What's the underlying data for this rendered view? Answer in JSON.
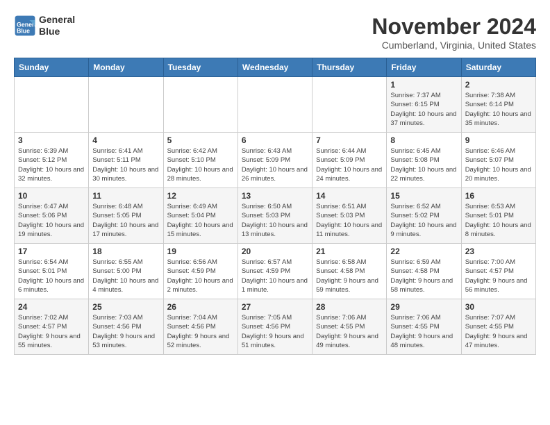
{
  "header": {
    "logo_line1": "General",
    "logo_line2": "Blue",
    "month_title": "November 2024",
    "location": "Cumberland, Virginia, United States"
  },
  "days_of_week": [
    "Sunday",
    "Monday",
    "Tuesday",
    "Wednesday",
    "Thursday",
    "Friday",
    "Saturday"
  ],
  "weeks": [
    [
      {
        "day": "",
        "info": ""
      },
      {
        "day": "",
        "info": ""
      },
      {
        "day": "",
        "info": ""
      },
      {
        "day": "",
        "info": ""
      },
      {
        "day": "",
        "info": ""
      },
      {
        "day": "1",
        "info": "Sunrise: 7:37 AM\nSunset: 6:15 PM\nDaylight: 10 hours and 37 minutes."
      },
      {
        "day": "2",
        "info": "Sunrise: 7:38 AM\nSunset: 6:14 PM\nDaylight: 10 hours and 35 minutes."
      }
    ],
    [
      {
        "day": "3",
        "info": "Sunrise: 6:39 AM\nSunset: 5:12 PM\nDaylight: 10 hours and 32 minutes."
      },
      {
        "day": "4",
        "info": "Sunrise: 6:41 AM\nSunset: 5:11 PM\nDaylight: 10 hours and 30 minutes."
      },
      {
        "day": "5",
        "info": "Sunrise: 6:42 AM\nSunset: 5:10 PM\nDaylight: 10 hours and 28 minutes."
      },
      {
        "day": "6",
        "info": "Sunrise: 6:43 AM\nSunset: 5:09 PM\nDaylight: 10 hours and 26 minutes."
      },
      {
        "day": "7",
        "info": "Sunrise: 6:44 AM\nSunset: 5:09 PM\nDaylight: 10 hours and 24 minutes."
      },
      {
        "day": "8",
        "info": "Sunrise: 6:45 AM\nSunset: 5:08 PM\nDaylight: 10 hours and 22 minutes."
      },
      {
        "day": "9",
        "info": "Sunrise: 6:46 AM\nSunset: 5:07 PM\nDaylight: 10 hours and 20 minutes."
      }
    ],
    [
      {
        "day": "10",
        "info": "Sunrise: 6:47 AM\nSunset: 5:06 PM\nDaylight: 10 hours and 19 minutes."
      },
      {
        "day": "11",
        "info": "Sunrise: 6:48 AM\nSunset: 5:05 PM\nDaylight: 10 hours and 17 minutes."
      },
      {
        "day": "12",
        "info": "Sunrise: 6:49 AM\nSunset: 5:04 PM\nDaylight: 10 hours and 15 minutes."
      },
      {
        "day": "13",
        "info": "Sunrise: 6:50 AM\nSunset: 5:03 PM\nDaylight: 10 hours and 13 minutes."
      },
      {
        "day": "14",
        "info": "Sunrise: 6:51 AM\nSunset: 5:03 PM\nDaylight: 10 hours and 11 minutes."
      },
      {
        "day": "15",
        "info": "Sunrise: 6:52 AM\nSunset: 5:02 PM\nDaylight: 10 hours and 9 minutes."
      },
      {
        "day": "16",
        "info": "Sunrise: 6:53 AM\nSunset: 5:01 PM\nDaylight: 10 hours and 8 minutes."
      }
    ],
    [
      {
        "day": "17",
        "info": "Sunrise: 6:54 AM\nSunset: 5:01 PM\nDaylight: 10 hours and 6 minutes."
      },
      {
        "day": "18",
        "info": "Sunrise: 6:55 AM\nSunset: 5:00 PM\nDaylight: 10 hours and 4 minutes."
      },
      {
        "day": "19",
        "info": "Sunrise: 6:56 AM\nSunset: 4:59 PM\nDaylight: 10 hours and 2 minutes."
      },
      {
        "day": "20",
        "info": "Sunrise: 6:57 AM\nSunset: 4:59 PM\nDaylight: 10 hours and 1 minute."
      },
      {
        "day": "21",
        "info": "Sunrise: 6:58 AM\nSunset: 4:58 PM\nDaylight: 9 hours and 59 minutes."
      },
      {
        "day": "22",
        "info": "Sunrise: 6:59 AM\nSunset: 4:58 PM\nDaylight: 9 hours and 58 minutes."
      },
      {
        "day": "23",
        "info": "Sunrise: 7:00 AM\nSunset: 4:57 PM\nDaylight: 9 hours and 56 minutes."
      }
    ],
    [
      {
        "day": "24",
        "info": "Sunrise: 7:02 AM\nSunset: 4:57 PM\nDaylight: 9 hours and 55 minutes."
      },
      {
        "day": "25",
        "info": "Sunrise: 7:03 AM\nSunset: 4:56 PM\nDaylight: 9 hours and 53 minutes."
      },
      {
        "day": "26",
        "info": "Sunrise: 7:04 AM\nSunset: 4:56 PM\nDaylight: 9 hours and 52 minutes."
      },
      {
        "day": "27",
        "info": "Sunrise: 7:05 AM\nSunset: 4:56 PM\nDaylight: 9 hours and 51 minutes."
      },
      {
        "day": "28",
        "info": "Sunrise: 7:06 AM\nSunset: 4:55 PM\nDaylight: 9 hours and 49 minutes."
      },
      {
        "day": "29",
        "info": "Sunrise: 7:06 AM\nSunset: 4:55 PM\nDaylight: 9 hours and 48 minutes."
      },
      {
        "day": "30",
        "info": "Sunrise: 7:07 AM\nSunset: 4:55 PM\nDaylight: 9 hours and 47 minutes."
      }
    ]
  ]
}
